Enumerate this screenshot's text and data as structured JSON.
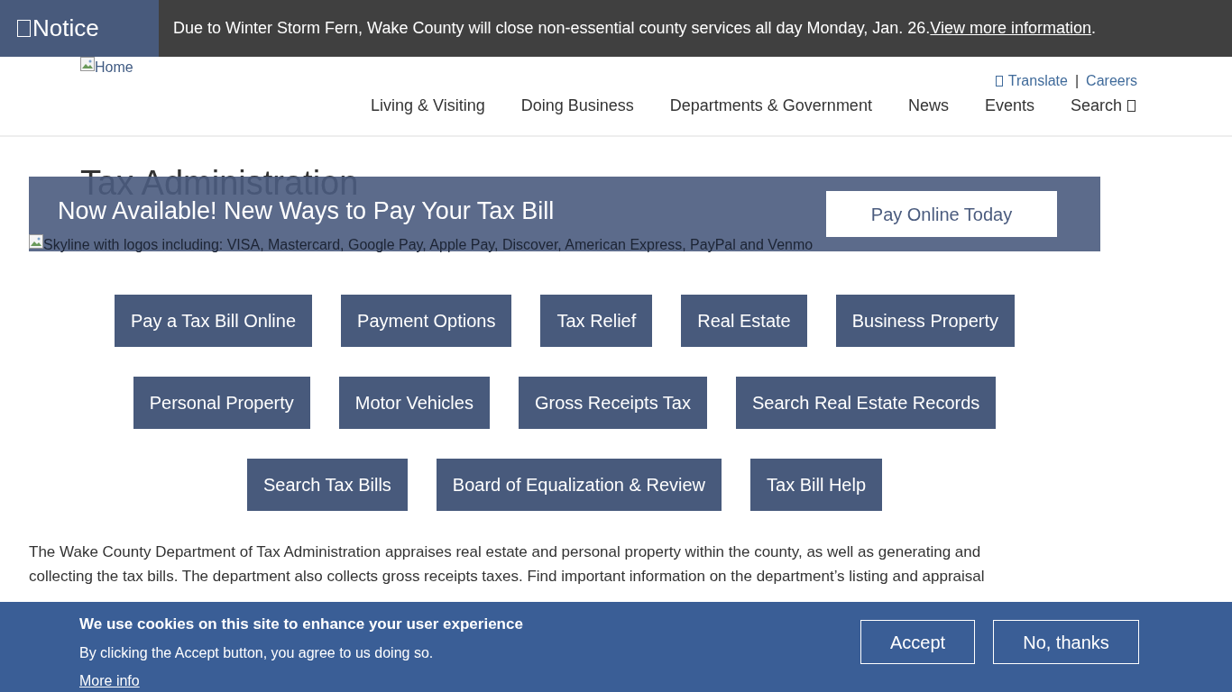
{
  "notice": {
    "label": "Notice",
    "message": "Due to Winter Storm Fern, Wake County will close non-essential county services all day Monday, Jan. 26. ",
    "link": "View more information",
    "after_link": "."
  },
  "header": {
    "logo_alt": "Home",
    "utility_links": [
      "Translate",
      "Careers"
    ],
    "separator": "|",
    "nav": [
      "Living & Visiting",
      "Doing Business",
      "Departments & Government",
      "News",
      "Events",
      "Search"
    ]
  },
  "page_title": "Tax Administration",
  "promo": {
    "headline": "Now Available! New Ways to Pay Your Tax Bill",
    "button": "Pay Online Today",
    "image_alt": "Skyline with logos including: VISA, Mastercard, Google Pay, Apple Pay, Discover, American Express, PayPal and Venmo"
  },
  "button_rows": [
    [
      "Pay a Tax Bill Online",
      "Payment Options",
      "Tax Relief",
      "Real Estate",
      "Business Property"
    ],
    [
      "Personal Property",
      "Motor Vehicles",
      "Gross Receipts Tax",
      "Search Real Estate Records"
    ],
    [
      "Search Tax Bills",
      "Board of Equalization & Review",
      "Tax Bill Help"
    ]
  ],
  "intro": "The Wake County Department of Tax Administration appraises real estate and personal property within the county, as well as generating and collecting the tax bills. The department also collects gross receipts taxes. Find important information on the department’s listing and appraisal",
  "cookie_banner": {
    "title": "We use cookies on this site to enhance your user experience",
    "text": "By clicking the Accept button, you agree to us doing so.",
    "more_info": "More info",
    "buttons": [
      "Accept",
      "No, thanks"
    ]
  }
}
